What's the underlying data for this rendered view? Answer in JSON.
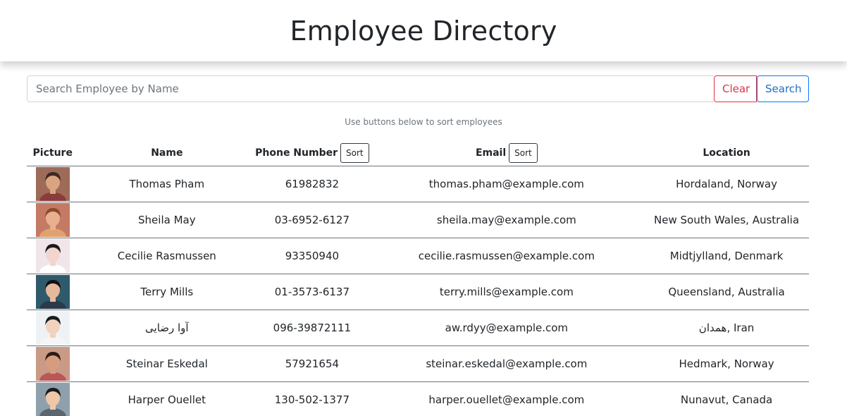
{
  "header": {
    "title": "Employee Directory"
  },
  "search": {
    "placeholder": "Search Employee by Name",
    "value": "",
    "clear_label": "Clear",
    "search_label": "Search"
  },
  "hint": "Use buttons below to sort employees",
  "table": {
    "columns": {
      "picture": "Picture",
      "name": "Name",
      "phone": "Phone Number",
      "email": "Email",
      "location": "Location",
      "sort_label": "Sort"
    },
    "rows": [
      {
        "name": "Thomas Pham",
        "phone": "61982832",
        "email": "thomas.pham@example.com",
        "location": "Hordaland, Norway",
        "avatar": {
          "bg": "#9e6b59",
          "skin": "#d9a47f",
          "hair": "#3a2a22",
          "shirt": "#8a3b3b"
        }
      },
      {
        "name": "Sheila May",
        "phone": "03-6952-6127",
        "email": "sheila.may@example.com",
        "location": "New South Wales, Australia",
        "avatar": {
          "bg": "#c47a64",
          "skin": "#e7b08e",
          "hair": "#8a4b2a",
          "shirt": "#e0a070"
        }
      },
      {
        "name": "Cecilie Rasmussen",
        "phone": "93350940",
        "email": "cecilie.rasmussen@example.com",
        "location": "Midtjylland, Denmark",
        "avatar": {
          "bg": "#f0e6ea",
          "skin": "#f2d5cf",
          "hair": "#1e1a1a",
          "shirt": "#ffffff"
        }
      },
      {
        "name": "Terry Mills",
        "phone": "01-3573-6137",
        "email": "terry.mills@example.com",
        "location": "Queensland, Australia",
        "avatar": {
          "bg": "#2f5a6b",
          "skin": "#e6b99c",
          "hair": "#111111",
          "shirt": "#2a3a4a"
        }
      },
      {
        "name": "آوا رضایی",
        "phone": "096-39872111",
        "email": "aw.rdyy@example.com",
        "location": "همدان, Iran",
        "avatar": {
          "bg": "#eef2f4",
          "skin": "#f1d2bd",
          "hair": "#1c1c1c",
          "shirt": "#f5f5f5"
        }
      },
      {
        "name": "Steinar Eskedal",
        "phone": "57921654",
        "email": "steinar.eskedal@example.com",
        "location": "Hedmark, Norway",
        "avatar": {
          "bg": "#c99a86",
          "skin": "#d79c7e",
          "hair": "#2b1c16",
          "shirt": "#b8585a"
        }
      },
      {
        "name": "Harper Ouellet",
        "phone": "130-502-1377",
        "email": "harper.ouellet@example.com",
        "location": "Nunavut, Canada",
        "avatar": {
          "bg": "#8fa0ad",
          "skin": "#f0c6a8",
          "hair": "#1a1a1a",
          "shirt": "#5b6770"
        }
      }
    ]
  }
}
